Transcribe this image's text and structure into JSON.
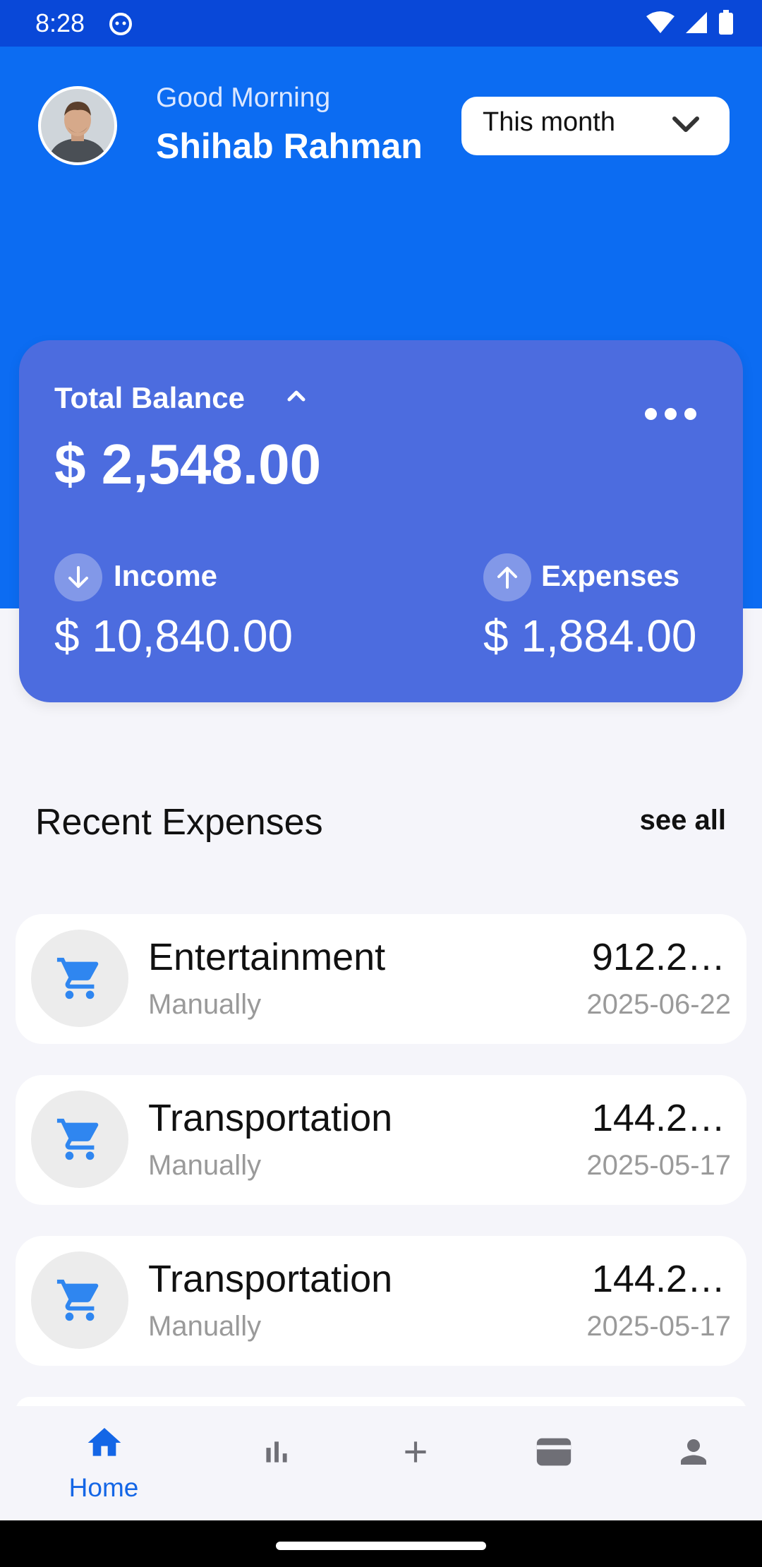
{
  "status_bar": {
    "time": "8:28"
  },
  "header": {
    "greeting": "Good Morning",
    "user_name": "Shihab Rahman",
    "period_select": {
      "value": "This month"
    }
  },
  "balance_card": {
    "title": "Total Balance",
    "amount": "$ 2,548.00",
    "income": {
      "label": "Income",
      "value": "$ 10,840.00"
    },
    "expenses": {
      "label": "Expenses",
      "value": "$ 1,884.00"
    }
  },
  "recent_expenses": {
    "title": "Recent Expenses",
    "see_all": "see all",
    "items": [
      {
        "category": "Entertainment",
        "source": "Manually",
        "amount": "912.2…",
        "date": "2025-06-22",
        "icon": "cart-icon"
      },
      {
        "category": "Transportation",
        "source": "Manually",
        "amount": "144.2…",
        "date": "2025-05-17",
        "icon": "cart-icon"
      },
      {
        "category": "Transportation",
        "source": "Manually",
        "amount": "144.2…",
        "date": "2025-05-17",
        "icon": "cart-icon"
      }
    ]
  },
  "bottom_nav": {
    "items": [
      {
        "label": "Home",
        "icon": "home-icon",
        "active": true
      },
      {
        "label": "",
        "icon": "bar-chart-icon",
        "active": false
      },
      {
        "label": "",
        "icon": "plus-icon",
        "active": false
      },
      {
        "label": "",
        "icon": "wallet-icon",
        "active": false
      },
      {
        "label": "",
        "icon": "person-icon",
        "active": false
      }
    ]
  },
  "colors": {
    "header_blue": "#0c6cf2",
    "status_blue": "#0948d8",
    "card_blue": "#4c6cdf",
    "accent_blue": "#1466e6",
    "icon_blue": "#2f86f0"
  }
}
